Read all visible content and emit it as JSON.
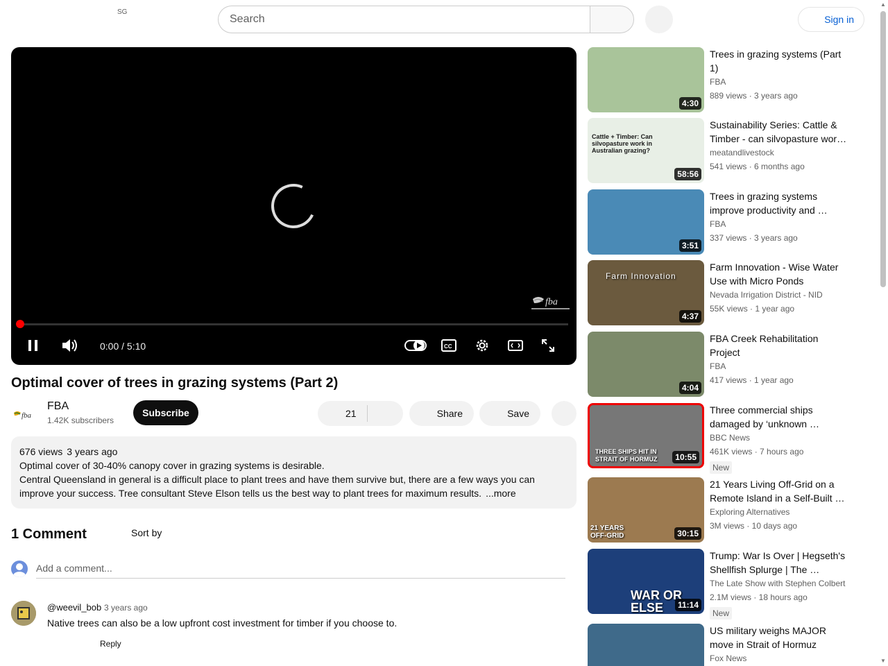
{
  "header": {
    "country_code": "SG",
    "search_placeholder": "Search",
    "sign_in_label": "Sign in"
  },
  "player": {
    "time_display": "0:00 / 5:10",
    "progress": 0
  },
  "video": {
    "title": "Optimal cover of trees in grazing systems (Part 2)",
    "channel_name": "FBA",
    "channel_avatar_text": "fba",
    "subscriber_count": "1.42K subscribers",
    "subscribe_label": "Subscribe",
    "like_count": "21",
    "share_label": "Share",
    "save_label": "Save"
  },
  "description": {
    "views": "676 views",
    "age": "3 years ago",
    "line1": "Optimal cover of 30-40% canopy cover in grazing systems is desirable.",
    "line2": "Central Queensland in general is a difficult place to plant trees and have them survive but, there are a few ways you can improve your success. Tree consultant Steve Elson tells us the best way to plant trees for maximum results.",
    "more_label": "...more"
  },
  "comments": {
    "header": "1 Comment",
    "sort_label": "Sort by",
    "add_placeholder": "Add a comment...",
    "items": [
      {
        "author": "@weevil_bob",
        "time": "3 years ago",
        "text": "Native trees can also be a low upfront cost investment for timber if you choose to.",
        "reply_label": "Reply"
      }
    ]
  },
  "recommendations": [
    {
      "title": "Trees in grazing systems (Part 1)",
      "channel": "FBA",
      "stats": "889 views · 3 years ago",
      "duration": "4:30",
      "badge": "",
      "thumb_color": "#a9c49a"
    },
    {
      "title": "Sustainability Series: Cattle & Timber - can silvopasture wor…",
      "channel": "meatandlivestock",
      "stats": "541 views · 6 months ago",
      "duration": "58:56",
      "badge": "",
      "thumb_color": "#e8efe6",
      "thumb_text": "Cattle + Timber: Can silvopasture work in Australian grazing?"
    },
    {
      "title": "Trees in grazing systems improve productivity and …",
      "channel": "FBA",
      "stats": "337 views · 3 years ago",
      "duration": "3:51",
      "badge": "",
      "thumb_color": "#4a8ab6"
    },
    {
      "title": "Farm Innovation - Wise Water Use with Micro Ponds",
      "channel": "Nevada Irrigation District - NID",
      "stats": "55K views · 1 year ago",
      "duration": "4:37",
      "badge": "",
      "thumb_color": "#6b5a3e",
      "thumb_text": "Farm Innovation"
    },
    {
      "title": "FBA Creek Rehabilitation Project",
      "channel": "FBA",
      "stats": "417 views · 1 year ago",
      "duration": "4:04",
      "badge": "",
      "thumb_color": "#7c8a6a"
    },
    {
      "title": "Three commercial ships damaged by ‘unknown …",
      "channel": "BBC News",
      "stats": "461K views · 7 hours ago",
      "duration": "10:55",
      "badge": "New",
      "thumb_color": "#777777",
      "thumb_text": "THREE SHIPS HIT IN STRAIT OF HORMUZ"
    },
    {
      "title": "21 Years Living Off-Grid on a Remote Island in a Self-Built …",
      "channel": "Exploring Alternatives",
      "stats": "3M views · 10 days ago",
      "duration": "30:15",
      "badge": "",
      "thumb_color": "#9c7a50",
      "thumb_text": "21 YEARS OFF-GRID"
    },
    {
      "title": "Trump: War Is Over | Hegseth's Shellfish Splurge | The …",
      "channel": "The Late Show with Stephen Colbert",
      "stats": "2.1M views · 18 hours ago",
      "duration": "11:14",
      "badge": "New",
      "thumb_color": "#1d3f7a",
      "thumb_text": "WAR OR ELSE"
    },
    {
      "title": "US military weighs MAJOR move in Strait of Hormuz",
      "channel": "Fox News",
      "stats": "",
      "duration": "",
      "badge": "",
      "thumb_color": "#3f6a8a"
    }
  ]
}
